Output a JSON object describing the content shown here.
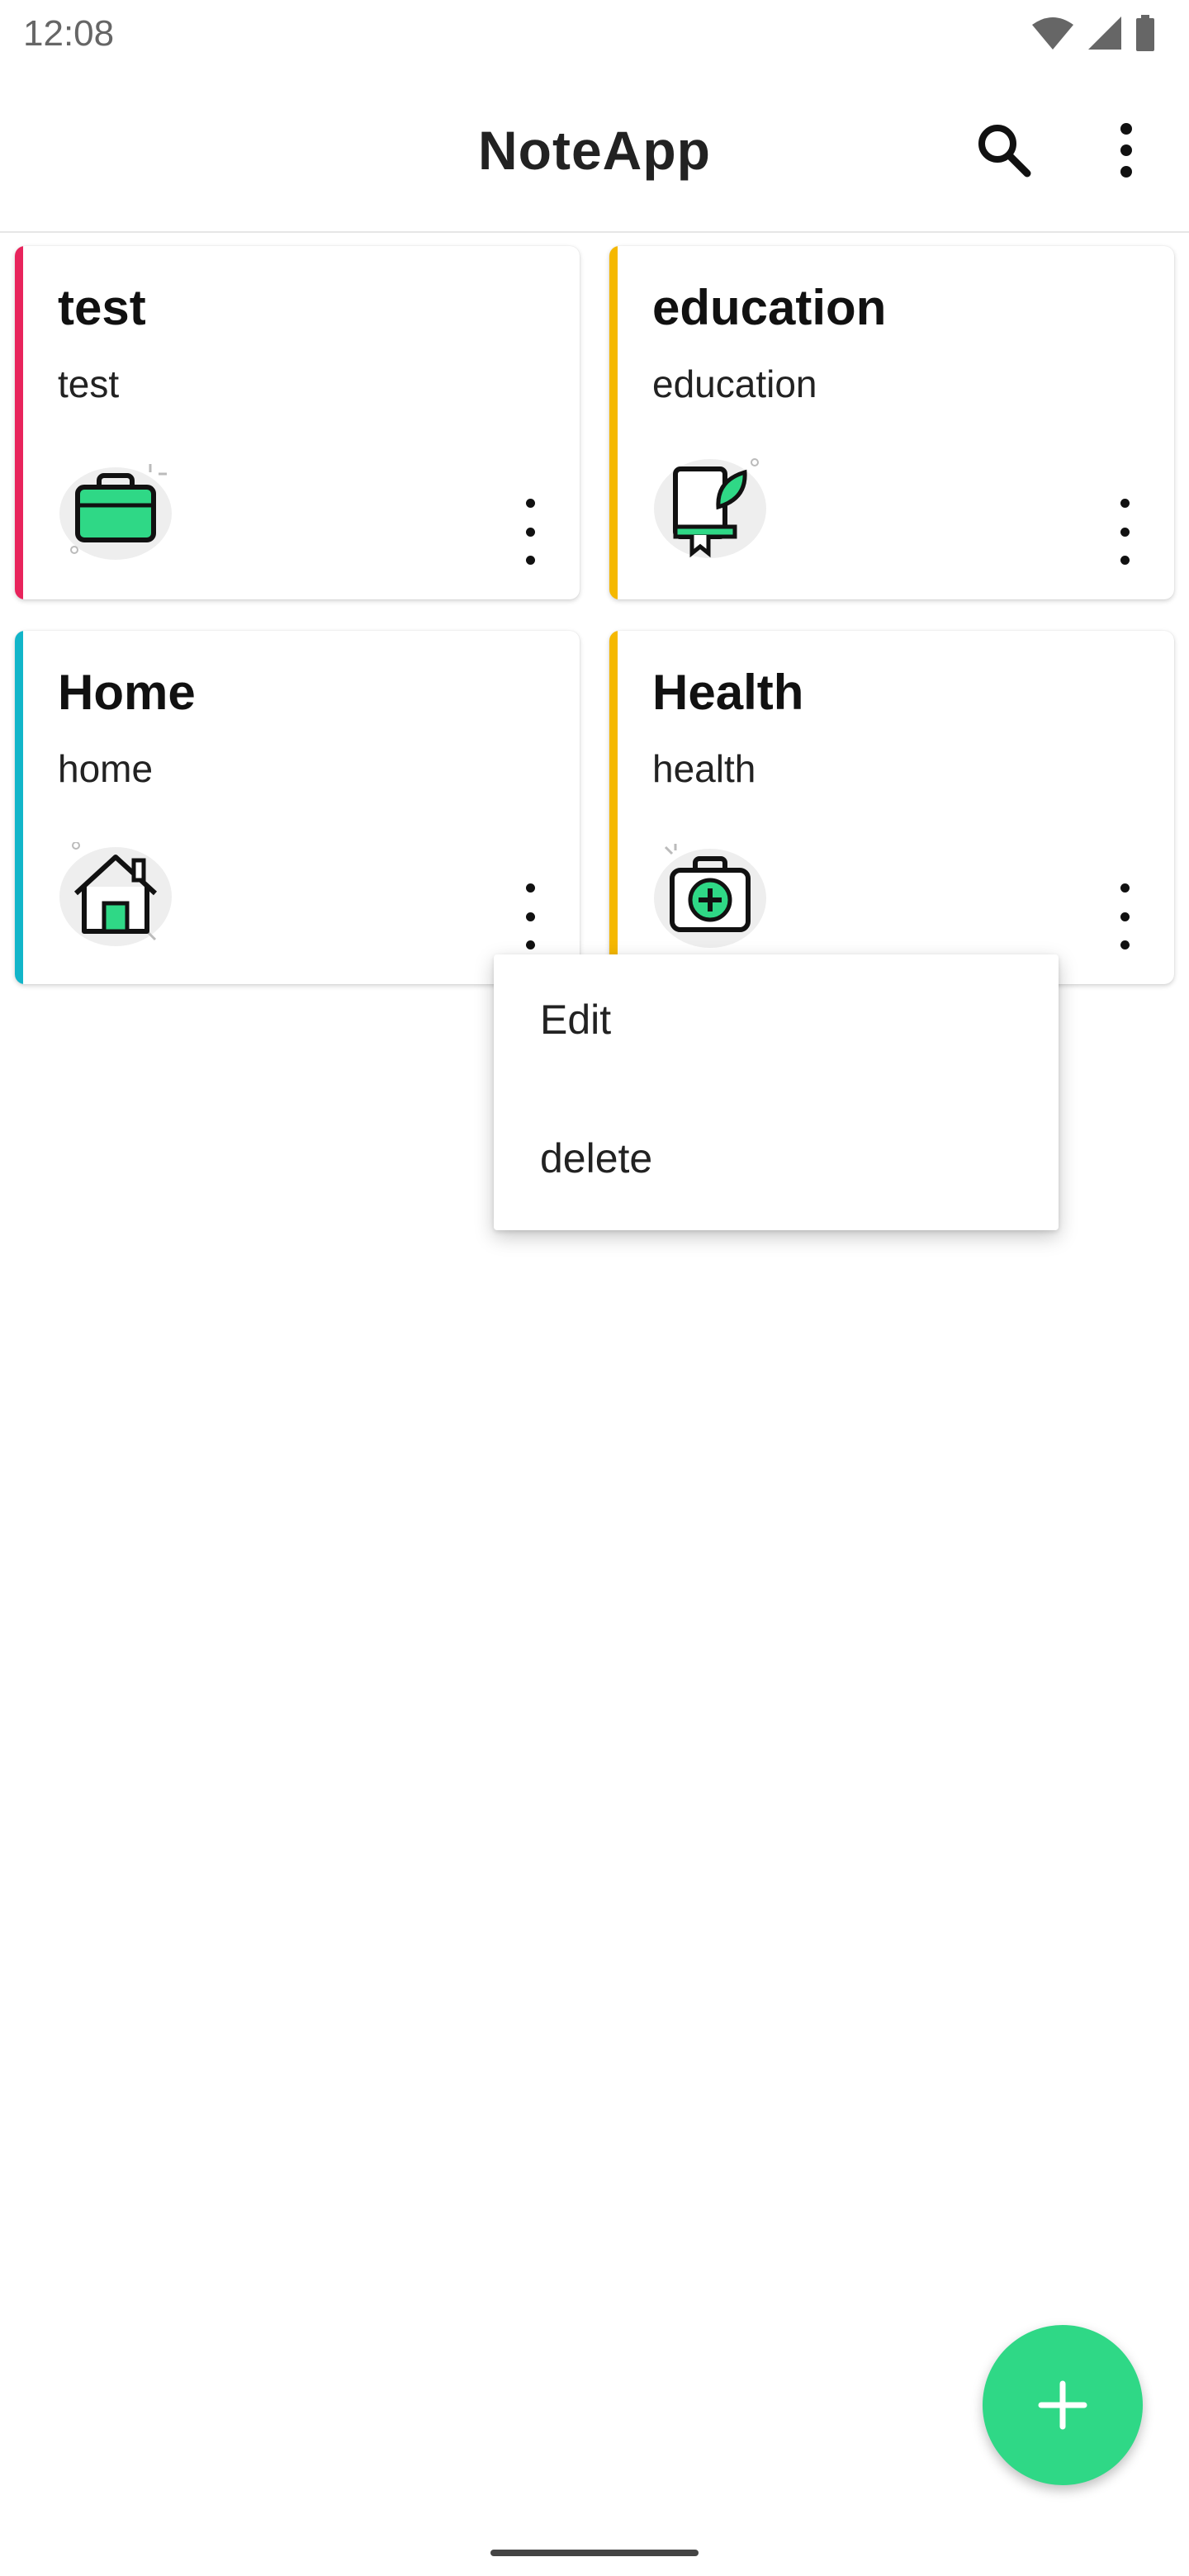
{
  "status_bar": {
    "time": "12:08"
  },
  "app_bar": {
    "title": "NoteApp",
    "search_icon": "search-icon",
    "more_icon": "more-vert-icon"
  },
  "notes": [
    {
      "title": "test",
      "description": "test",
      "category_icon": "briefcase-icon",
      "stripe_color": "#e8245c"
    },
    {
      "title": "education",
      "description": "education",
      "category_icon": "book-leaf-icon",
      "stripe_color": "#f5b800"
    },
    {
      "title": "Home",
      "description": "home",
      "category_icon": "house-icon",
      "stripe_color": "#12b5c9"
    },
    {
      "title": "Health",
      "description": "health",
      "category_icon": "medical-kit-icon",
      "stripe_color": "#f5b800"
    }
  ],
  "popup_menu": {
    "items": [
      "Edit",
      "delete"
    ]
  },
  "fab": {
    "icon": "plus-icon",
    "color": "#2fd886"
  },
  "colors": {
    "accent": "#2fd886",
    "icon_green": "#2fd886"
  }
}
